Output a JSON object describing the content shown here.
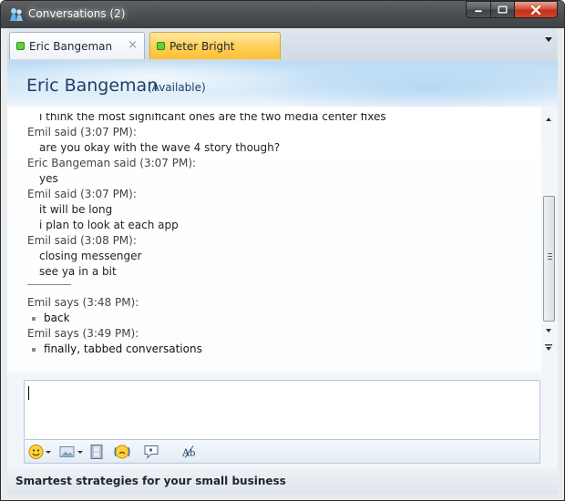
{
  "window": {
    "title": "Conversations (2)",
    "icons": {
      "app": "messenger-icon",
      "minimize": "minimize-icon",
      "maximize": "maximize-icon",
      "close": "close-icon"
    }
  },
  "tabs": [
    {
      "label": "Eric Bangeman",
      "active": true,
      "status": "online",
      "close_glyph": "×"
    },
    {
      "label": "Peter Bright",
      "active": false,
      "status": "online",
      "highlighted": true
    }
  ],
  "header": {
    "contact_name": "Eric Bangeman",
    "contact_status": "(Available)"
  },
  "messages": [
    {
      "type": "text",
      "text": "i think the most significant ones are the two media center fixes"
    },
    {
      "type": "said",
      "text": "Emil said (3:07 PM):"
    },
    {
      "type": "text",
      "text": "are you okay with the wave 4 story though?"
    },
    {
      "type": "said",
      "text": "Eric Bangeman said (3:07 PM):"
    },
    {
      "type": "text",
      "text": "yes"
    },
    {
      "type": "said",
      "text": "Emil said (3:07 PM):"
    },
    {
      "type": "text",
      "text": "it will be long"
    },
    {
      "type": "text",
      "text": "i plan to look at each app"
    },
    {
      "type": "said",
      "text": "Emil said (3:08 PM):"
    },
    {
      "type": "text",
      "text": "closing messenger"
    },
    {
      "type": "text",
      "text": "see ya in a bit"
    },
    {
      "type": "says",
      "text": "Emil says (3:48 PM):"
    },
    {
      "type": "bullet",
      "text": "back"
    },
    {
      "type": "says",
      "text": "Emil says (3:49 PM):"
    },
    {
      "type": "bullet",
      "text": "finally, tabbed conversations"
    }
  ],
  "input": {
    "value": ""
  },
  "toolbar": {
    "items": [
      "emoticon-icon",
      "wink-image-icon",
      "film-icon",
      "nudge-icon",
      "voice-clip-icon",
      "font-icon"
    ]
  },
  "ad": {
    "text": "Smartest strategies for your small business"
  },
  "colors": {
    "status_online": "#5ed33b",
    "active_tab": "#ffcf56",
    "contact_name": "#1e3f66"
  }
}
